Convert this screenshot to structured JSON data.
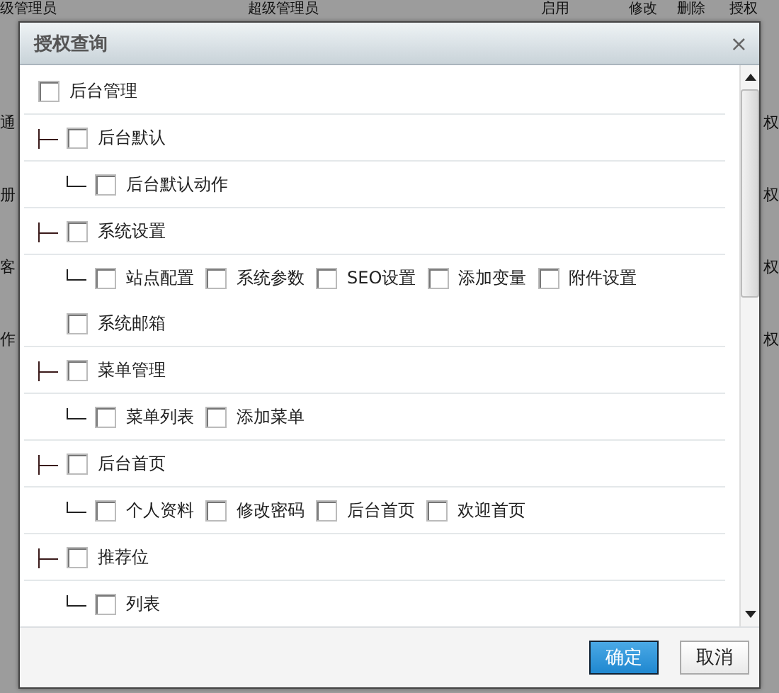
{
  "backdrop": {
    "top_row": [
      "级管理员",
      "超级管理员",
      "启用",
      "修改",
      "删除",
      "授权"
    ],
    "left_column": [
      "通",
      "册",
      "客",
      "作"
    ],
    "right_column": [
      "权",
      "权",
      "权",
      "权"
    ]
  },
  "dialog": {
    "title": "授权查询",
    "close": "×",
    "tree": {
      "label": "后台管理",
      "checked": false,
      "children": [
        {
          "label": "后台默认",
          "checked": false,
          "children": [
            {
              "label": "后台默认动作",
              "checked": false
            }
          ]
        },
        {
          "label": "系统设置",
          "checked": false,
          "children": [
            {
              "label": "站点配置",
              "checked": false
            },
            {
              "label": "系统参数",
              "checked": false
            },
            {
              "label": "SEO设置",
              "checked": false
            },
            {
              "label": "添加变量",
              "checked": false
            },
            {
              "label": "附件设置",
              "checked": false
            },
            {
              "label": "系统邮箱",
              "checked": false
            }
          ]
        },
        {
          "label": "菜单管理",
          "checked": false,
          "children": [
            {
              "label": "菜单列表",
              "checked": false
            },
            {
              "label": "添加菜单",
              "checked": false
            }
          ]
        },
        {
          "label": "后台首页",
          "checked": false,
          "children": [
            {
              "label": "个人资料",
              "checked": false
            },
            {
              "label": "修改密码",
              "checked": false
            },
            {
              "label": "后台首页",
              "checked": false
            },
            {
              "label": "欢迎首页",
              "checked": false
            }
          ]
        },
        {
          "label": "推荐位",
          "checked": false,
          "children": [
            {
              "label": "列表",
              "checked": false
            }
          ]
        }
      ]
    },
    "buttons": [
      {
        "label": "确定",
        "kind": "primary"
      },
      {
        "label": "取消",
        "kind": "secondary"
      }
    ]
  }
}
